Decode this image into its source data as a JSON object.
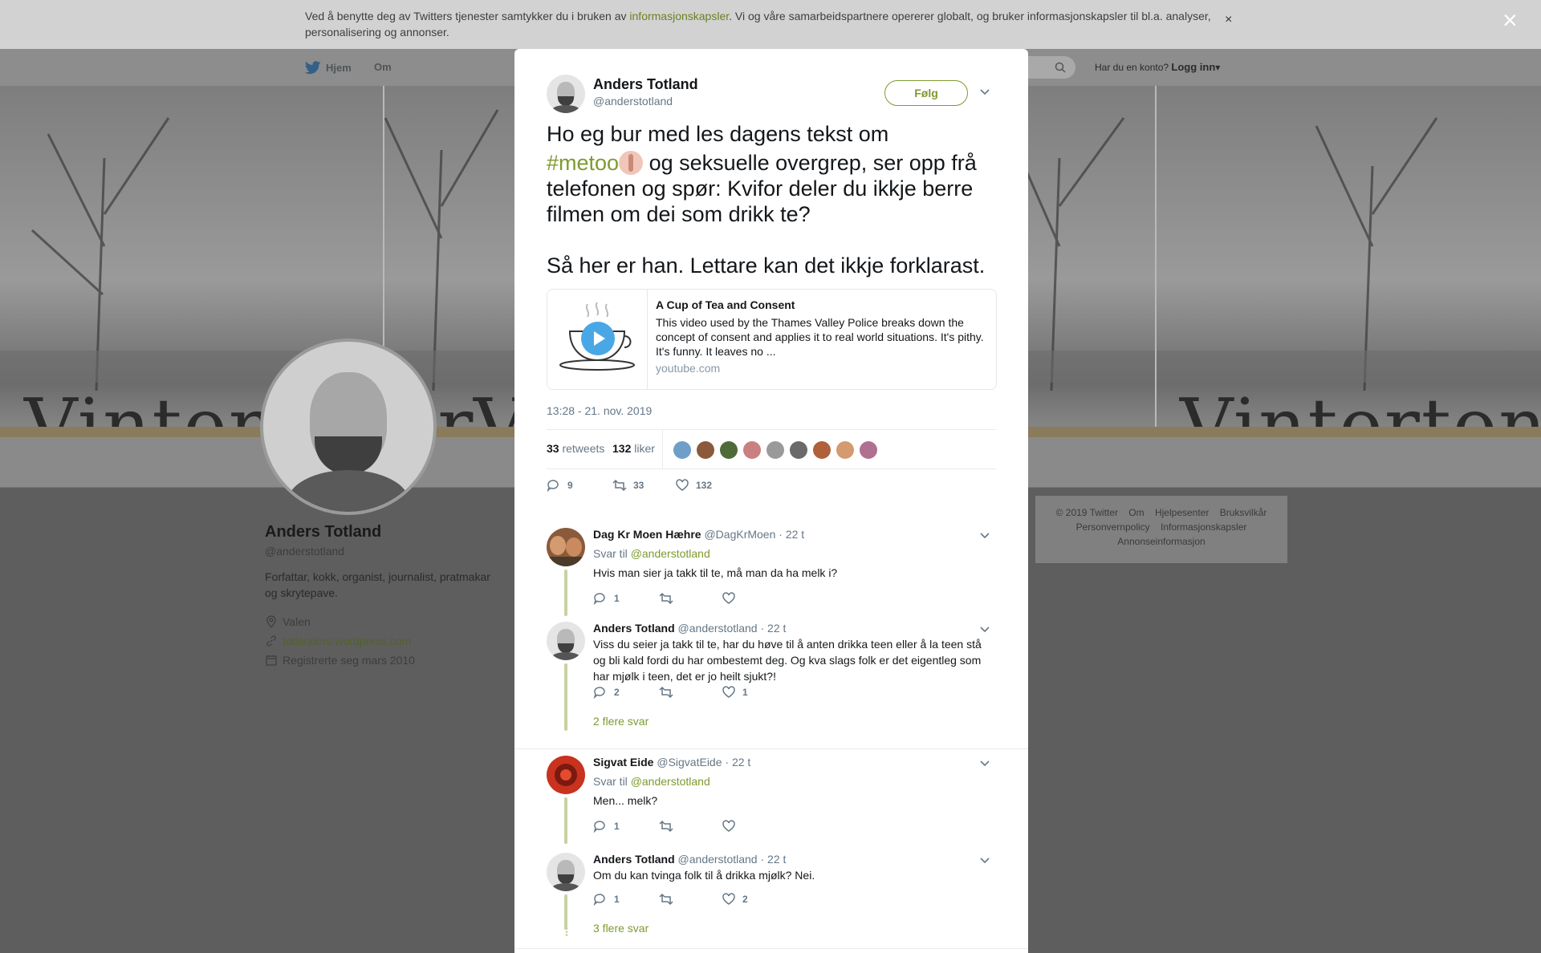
{
  "cookie": {
    "text_before": "Ved å benytte deg av Twitters tjenester samtykker du i bruken av ",
    "link": "informasjonskapsler",
    "text_after": ". Vi og våre samarbeidspartnere opererer globalt, og bruker informasjonskapsler til bl.a. analyser, personalisering og annonser.",
    "close": "×"
  },
  "nav": {
    "home": "Hjem",
    "about": "Om",
    "login_prompt": "Har du en konto?",
    "login": "Logg inn",
    "caret": "▾"
  },
  "banner": {
    "word": "Vintertonar"
  },
  "profile": {
    "name": "Anders Totland",
    "handle": "@anderstotland",
    "bio": "Forfattar, kokk, organist, journalist, pratmakar og skrytepave.",
    "location": "Valen",
    "website": "totlanders.wordpress.com",
    "joined": "Registrerte seg mars 2010"
  },
  "footer": {
    "links": [
      "© 2019 Twitter",
      "Om",
      "Hjelpesenter",
      "Bruksvilkår",
      "Personvernpolicy",
      "Informasjonskapsler",
      "Annonseinformasjon"
    ]
  },
  "overlay_close": "×",
  "tweet": {
    "author_name": "Anders Totland",
    "author_handle": "@anderstotland",
    "follow_label": "Følg",
    "text_line1": "Ho eg bur med les dagens tekst om",
    "hashtag": "#metoo",
    "text_rest": " og seksuelle overgrep, ser opp frå telefonen og spør: Kvifor deler du ikkje berre filmen om dei som drikk te?",
    "text_line2": "Så her er han. Lettare kan det ikkje forklarast.",
    "card": {
      "title": "A Cup of Tea and Consent",
      "description": "This video used by the Thames Valley Police breaks down the concept of consent and applies it to real world situations. It's pithy. It's funny. It leaves no ...",
      "domain": "youtube.com"
    },
    "timestamp": "13:28 - 21. nov. 2019",
    "retweets_count": "33",
    "retweets_label": "retweets",
    "likes_count": "132",
    "likes_label": "liker",
    "actions": {
      "replies": "9",
      "retweets": "33",
      "likes": "132"
    },
    "liker_avatar_colors": [
      "#6f9fc8",
      "#8a5a3a",
      "#4f6b3a",
      "#c98080",
      "#9a9a9a",
      "#6a6a6a",
      "#b0603a",
      "#d49a70",
      "#b07090"
    ]
  },
  "replies": [
    {
      "name": "Dag Kr Moen Hæhre",
      "handle": "@DagKrMoen",
      "time": "· 22 t",
      "reply_to_label": "Svar til",
      "reply_to": "@anderstotland",
      "text": "Hvis man sier ja takk til te, må man da ha melk i?",
      "replies": "1",
      "retweets": "",
      "likes": ""
    },
    {
      "name": "Anders Totland",
      "handle": "@anderstotland",
      "time": "· 22 t",
      "text": "Viss du seier ja takk til te, har du høve til å anten drikka teen eller å la teen stå og bli kald fordi du har ombestemt deg. Og kva slags folk er det eigentleg som har mjølk i teen, det er jo heilt sjukt?!",
      "replies": "2",
      "retweets": "",
      "likes": "1",
      "more": "2 flere svar"
    },
    {
      "name": "Sigvat Eide",
      "handle": "@SigvatEide",
      "time": "· 22 t",
      "reply_to_label": "Svar til",
      "reply_to": "@anderstotland",
      "text": "Men... melk?",
      "replies": "1",
      "retweets": "",
      "likes": ""
    },
    {
      "name": "Anders Totland",
      "handle": "@anderstotland",
      "time": "· 22 t",
      "text": "Om du kan tvinga folk til å drikka mjølk? Nei.",
      "replies": "1",
      "retweets": "",
      "likes": "2",
      "more": "3 flere svar"
    }
  ],
  "colors": {
    "accent": "#7e9a2f",
    "thread": "#c6d2a2",
    "muted": "#657786"
  }
}
